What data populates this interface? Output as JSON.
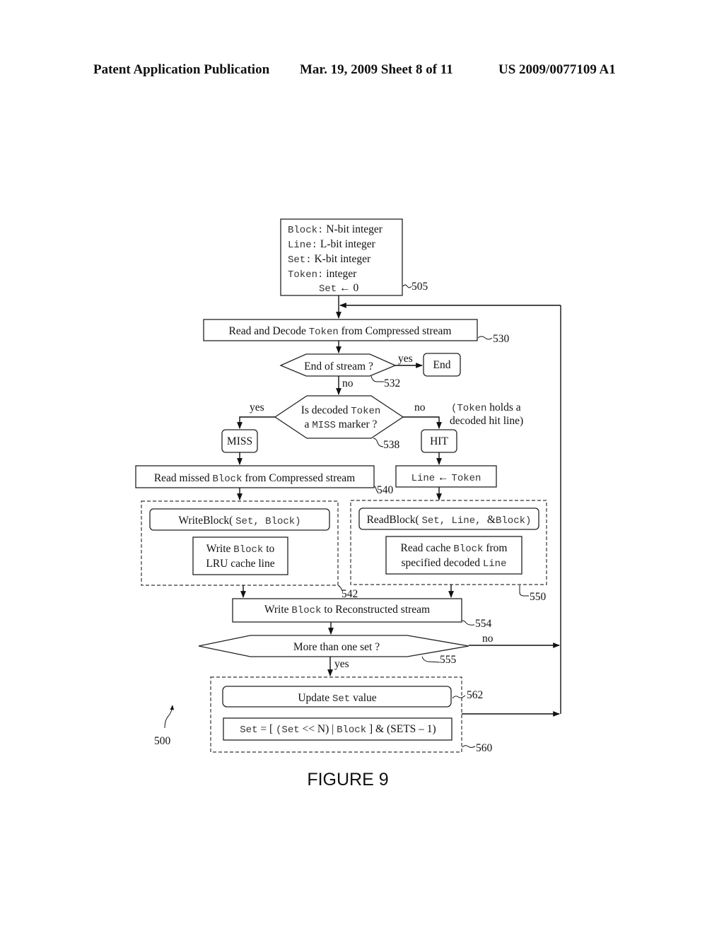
{
  "header": {
    "publication": "Patent Application Publication",
    "date_sheet": "Mar. 19, 2009  Sheet 8 of 11",
    "number": "US 2009/0077109 A1"
  },
  "diagram": {
    "figure_label": "FIGURE 9",
    "figure_ref": "500",
    "init_box": {
      "ref": "505",
      "lines": [
        {
          "code": "Block:",
          "text": " N-bit integer"
        },
        {
          "code": "Line:",
          "text": " L-bit integer"
        },
        {
          "code": "Set:",
          "text": " K-bit integer"
        },
        {
          "code": "Token:",
          "text": " integer"
        },
        {
          "code": "Set",
          "text": " ← 0"
        }
      ]
    },
    "read_decode": {
      "ref": "530",
      "pre": "Read and Decode ",
      "code": "Token",
      "post": " from Compressed stream"
    },
    "end_of_stream": {
      "ref": "532",
      "label": "End of stream ?",
      "yes": "yes",
      "no": "no"
    },
    "end": {
      "label": "End"
    },
    "miss_check": {
      "ref": "538",
      "line1_pre": "Is decoded ",
      "line1_code": "Token",
      "line2_pre": "a ",
      "line2_code": "MISS",
      "line2_post": " marker ?",
      "yes": "yes",
      "no": "no"
    },
    "hit_note": {
      "code": "(Token",
      "line1_post": " holds a",
      "line2": "decoded hit line)"
    },
    "miss": {
      "label": "MISS"
    },
    "hit": {
      "label": "HIT"
    },
    "read_missed": {
      "ref": "540",
      "pre": "Read missed ",
      "code": "Block",
      "post": " from Compressed stream"
    },
    "line_assign": {
      "code_left": "Line",
      "arrow": " ← ",
      "code_right": "Token"
    },
    "write_group": {
      "ref": "542",
      "call_pre": "WriteBlock( ",
      "call_code": "Set, Block)",
      "desc_line1_pre": "Write ",
      "desc_line1_code": "Block",
      "desc_line1_post": " to",
      "desc_line2": "LRU cache line"
    },
    "read_group": {
      "ref": "550",
      "call_pre": "ReadBlock( ",
      "call_code1": "Set, Line, ",
      "call_amp": "&",
      "call_code2": "Block)",
      "desc_line1_pre": "Read cache ",
      "desc_line1_code": "Block",
      "desc_line1_post": " from",
      "desc_line2_pre": "specified decoded ",
      "desc_line2_code": "Line"
    },
    "write_reconstructed": {
      "ref": "554",
      "pre": "Write ",
      "code": "Block",
      "post": " to Reconstructed stream"
    },
    "more_sets": {
      "ref": "555",
      "label": "More than one set ?",
      "yes": "yes",
      "no": "no"
    },
    "update_group": {
      "ref": "560",
      "update_ref": "562",
      "update_pre": "Update ",
      "update_code": "Set",
      "update_post": " value",
      "formula": {
        "c1": "Set",
        "t1": " = [ ",
        "c2": "(Set",
        "t2": " << N) | ",
        "c3": "Block",
        "t3": " ] & (SETS – 1)"
      }
    }
  }
}
